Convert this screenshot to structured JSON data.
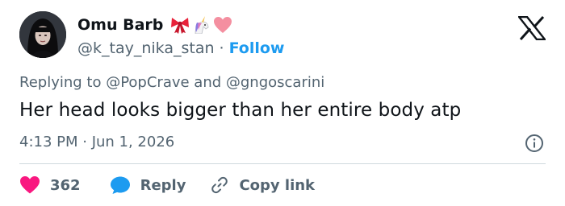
{
  "author": {
    "display_name": "Omu Barb",
    "handle": "@k_tay_nika_stan",
    "follow_label": "Follow",
    "separator": "·",
    "emojis": [
      "ribbon-icon",
      "unicorn-icon",
      "heart-icon"
    ]
  },
  "platform_logo": "x-logo",
  "tweet": {
    "replying_to": "Replying to @PopCrave and @gngoscarini",
    "text": "Her head looks bigger than her entire body atp",
    "timestamp": "4:13 PM · Jun 1, 2026"
  },
  "actions": {
    "like_count": "362",
    "reply_label": "Reply",
    "copy_link_label": "Copy link"
  },
  "colors": {
    "text_primary": "#0f1419",
    "text_secondary": "#536471",
    "accent": "#1d9bf0",
    "like": "#f91880",
    "divider": "#cfd9de"
  }
}
